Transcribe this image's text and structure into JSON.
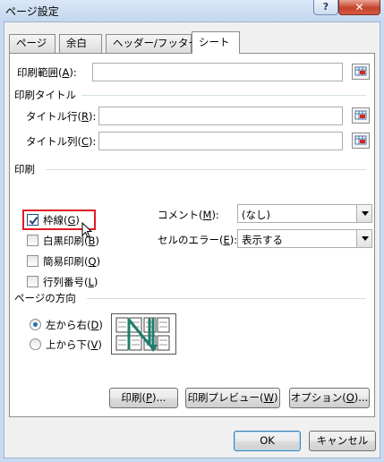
{
  "window": {
    "title": "ページ設定",
    "help_label": "?",
    "close_label": "✕"
  },
  "tabs": [
    {
      "label": "ページ",
      "active": false
    },
    {
      "label": "余白",
      "active": false
    },
    {
      "label": "ヘッダー/フッター",
      "active": false
    },
    {
      "label": "シート",
      "active": true
    }
  ],
  "print_area": {
    "label": "印刷範囲(",
    "key": "A",
    "suffix": "):",
    "value": ""
  },
  "print_titles": {
    "group_label": "印刷タイトル",
    "rows": {
      "label": "タイトル行(",
      "key": "R",
      "suffix": "):",
      "value": ""
    },
    "cols": {
      "label": "タイトル列(",
      "key": "C",
      "suffix": "):",
      "value": ""
    }
  },
  "print": {
    "group_label": "印刷",
    "gridlines": {
      "label": "枠線(",
      "key": "G",
      "suffix": ")",
      "checked": true
    },
    "black_white": {
      "label": "白黒印刷(",
      "key": "B",
      "suffix": ")",
      "checked": false
    },
    "draft": {
      "label": "簡易印刷(",
      "key": "Q",
      "suffix": ")",
      "checked": false
    },
    "headings": {
      "label": "行列番号(",
      "key": "L",
      "suffix": ")",
      "checked": false
    },
    "comments": {
      "label": "コメント(",
      "key": "M",
      "suffix": "):",
      "value": "(なし)"
    },
    "errors": {
      "label": "セルのエラー(",
      "key": "E",
      "suffix": "):",
      "value": "表示する"
    }
  },
  "page_order": {
    "group_label": "ページの方向",
    "down_then_over": {
      "label": "左から右(",
      "key": "D",
      "suffix": ")",
      "selected": true
    },
    "over_then_down": {
      "label": "上から下(",
      "key": "V",
      "suffix": ")",
      "selected": false
    }
  },
  "buttons": {
    "print": {
      "label": "印刷(",
      "key": "P",
      "suffix": ")..."
    },
    "preview": {
      "label": "印刷プレビュー(",
      "key": "W",
      "suffix": ")"
    },
    "options": {
      "label": "オプション(",
      "key": "O",
      "suffix": ")..."
    },
    "ok": "OK",
    "cancel": "キャンセル"
  },
  "colors": {
    "highlight_box": "#e01b24",
    "accent": "#2a6fb5",
    "arrow": "#1e7d6b"
  },
  "icons": [
    "range-picker-icon",
    "checkmark-icon",
    "page-order-arrow-icon",
    "mouse-cursor-icon"
  ]
}
